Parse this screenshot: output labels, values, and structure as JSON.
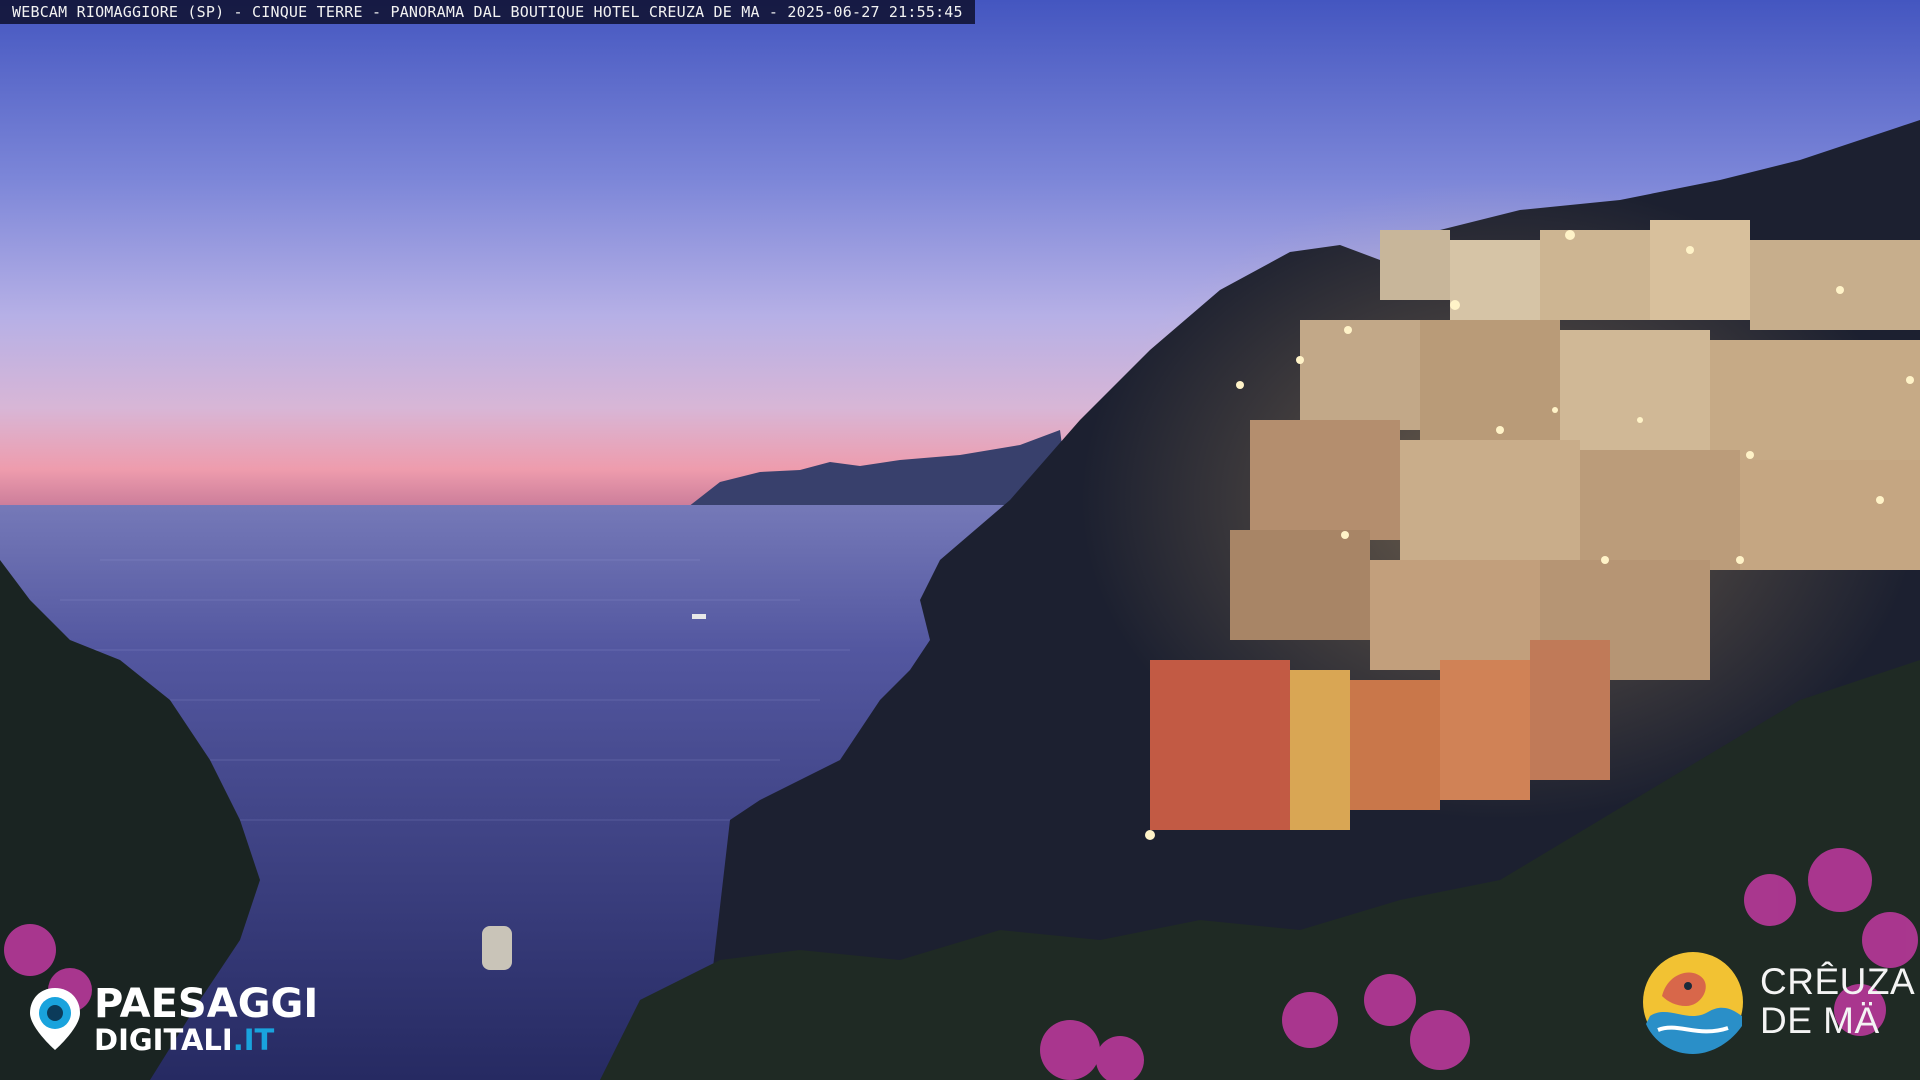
{
  "caption": {
    "text": "WEBCAM RIOMAGGIORE (SP) - CINQUE TERRE - PANORAMA DAL BOUTIQUE HOTEL CREUZA DE MA - 2025-06-27 21:55:45"
  },
  "logos": {
    "left": {
      "line1": "PAESAGGI",
      "line2_main": "DIGITALI",
      "line2_suffix": ".IT",
      "icon": "eye-pin-icon"
    },
    "right": {
      "line1": "CRÊUZA",
      "line2": "DE MÄ",
      "icon": "bird-wave-emblem-icon"
    }
  },
  "scene": {
    "description_colors": {
      "sky_top": "#4a5bc4",
      "sky_mid": "#9a9ee0",
      "horizon_glow": "#e88a9c",
      "sea": "#3b3f86",
      "cliff": "#1e2230",
      "flowers": "#b83c9c"
    }
  }
}
